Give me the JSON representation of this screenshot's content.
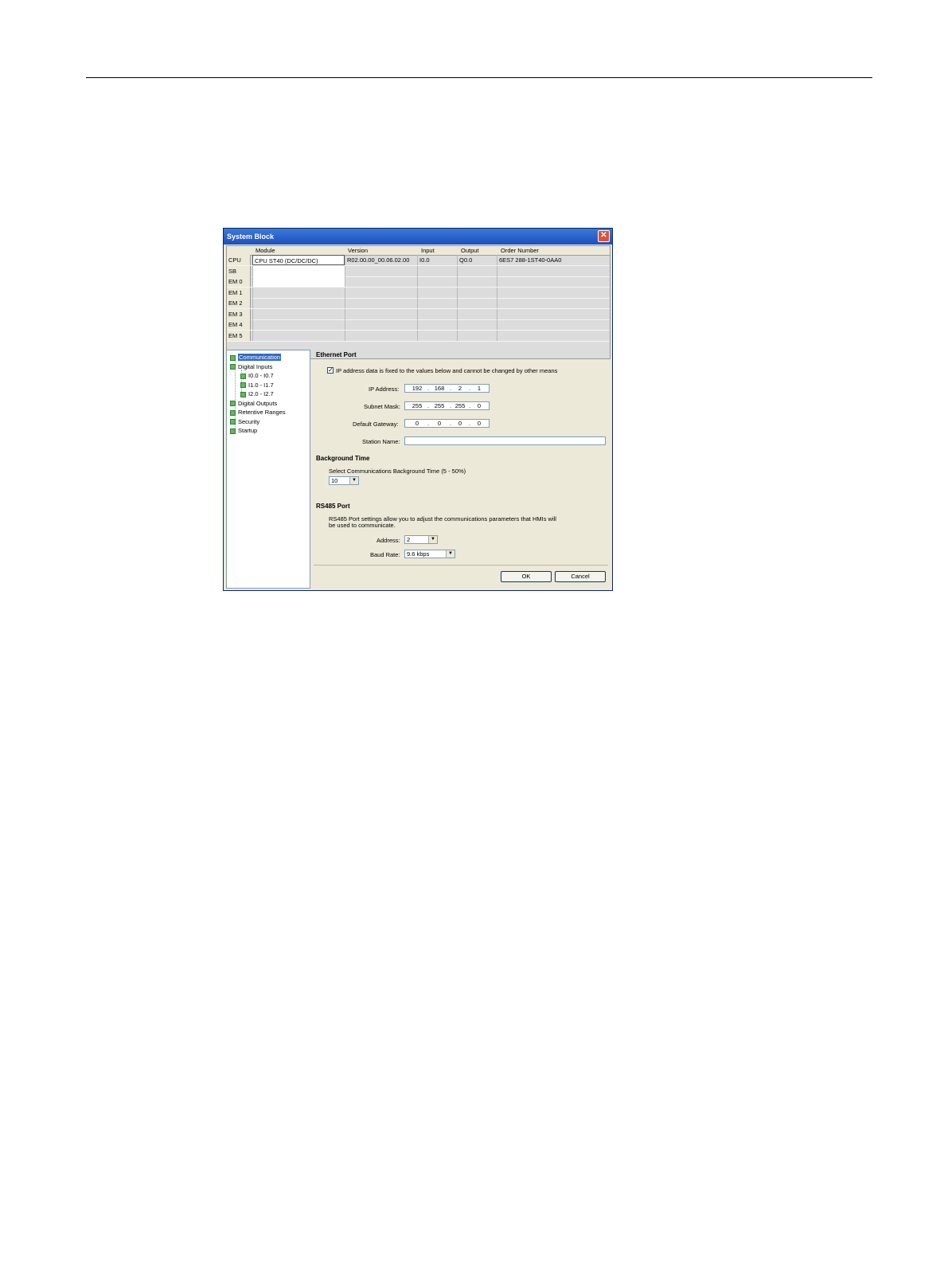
{
  "dialog": {
    "title": "System Block",
    "close_label": "✕"
  },
  "grid": {
    "headers": [
      "Module",
      "Version",
      "Input",
      "Output",
      "Order Number"
    ],
    "rows": [
      {
        "label": "CPU",
        "module": "CPU ST40 (DC/DC/DC)",
        "version": "R02.00.00_00.06.02.00",
        "input": "I0.0",
        "output": "Q0.0",
        "order": "6ES7 288-1ST40-0AA0"
      },
      {
        "label": "SB",
        "module": "",
        "version": "",
        "input": "",
        "output": "",
        "order": ""
      },
      {
        "label": "EM 0",
        "module": "",
        "version": "",
        "input": "",
        "output": "",
        "order": ""
      },
      {
        "label": "EM 1",
        "module": "",
        "version": "",
        "input": "",
        "output": "",
        "order": ""
      },
      {
        "label": "EM 2",
        "module": "",
        "version": "",
        "input": "",
        "output": "",
        "order": ""
      },
      {
        "label": "EM 3",
        "module": "",
        "version": "",
        "input": "",
        "output": "",
        "order": ""
      },
      {
        "label": "EM 4",
        "module": "",
        "version": "",
        "input": "",
        "output": "",
        "order": ""
      },
      {
        "label": "EM 5",
        "module": "",
        "version": "",
        "input": "",
        "output": "",
        "order": ""
      }
    ]
  },
  "tree": {
    "items": [
      "Communication",
      "Digital Inputs",
      "I0.0 - I0.7",
      "I1.0 - I1.7",
      "I2.0 - I2.7",
      "Digital Outputs",
      "Retentive Ranges",
      "Security",
      "Startup"
    ],
    "selected": "Communication"
  },
  "ethernet": {
    "title": "Ethernet Port",
    "fixed_ip_label": "IP address data is fixed to the values below and cannot be changed by other means",
    "fixed_ip_checked": "✓",
    "ip_label": "IP Address:",
    "ip": [
      "192",
      "168",
      "2",
      "1"
    ],
    "mask_label": "Subnet Mask:",
    "mask": [
      "255",
      "255",
      "255",
      "0"
    ],
    "gateway_label": "Default Gateway:",
    "gateway": [
      "0",
      "0",
      "0",
      "0"
    ],
    "station_label": "Station Name:",
    "station_value": ""
  },
  "background": {
    "title": "Background Time",
    "select_label": "Select Communications Background Time (5 - 50%)",
    "value": "10"
  },
  "rs485": {
    "title": "RS485 Port",
    "description_line1": "RS485 Port settings allow you to adjust the communications parameters that HMIs will",
    "description_line2": "be used to communicate.",
    "address_label": "Address:",
    "address_value": "2",
    "baud_label": "Baud Rate:",
    "baud_value": "9.6 kbps"
  },
  "buttons": {
    "ok": "OK",
    "cancel": "Cancel"
  },
  "icons": {
    "dropdown": "▼",
    "ip_dot": "."
  }
}
